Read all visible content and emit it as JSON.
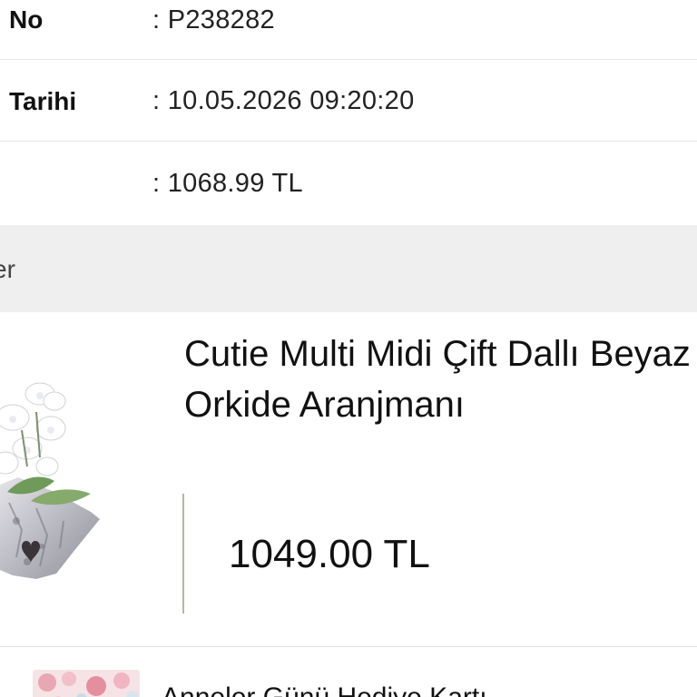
{
  "order_info": {
    "number": {
      "label": "No",
      "value": ": P238282"
    },
    "date": {
      "label": "Tarihi",
      "value": ": 10.05.2026 09:20:20"
    },
    "total": {
      "label": "",
      "value": ": 1068.99 TL"
    }
  },
  "products_section": {
    "header": "er"
  },
  "products": [
    {
      "name": "Cutie Multi Midi Çift Dallı Beyaz Orkide Aranjmanı",
      "price": "1049.00 TL",
      "image_icon": "orchid-arrangement-image"
    },
    {
      "name": "Anneler Günü Hediye Kartı",
      "image_icon": "floral-card-image"
    }
  ],
  "colors": {
    "section_header_bg": "#efefef",
    "divider": "#b8b4a8"
  }
}
